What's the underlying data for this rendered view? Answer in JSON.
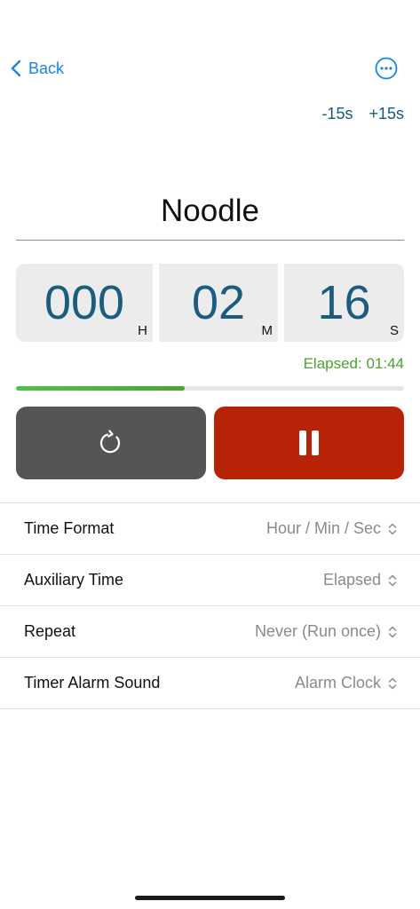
{
  "nav": {
    "back_label": "Back"
  },
  "adjust": {
    "minus_label": "-15s",
    "plus_label": "+15s"
  },
  "timer": {
    "name": "Noodle",
    "hours": "000",
    "hours_unit": "H",
    "minutes": "02",
    "minutes_unit": "M",
    "seconds": "16",
    "seconds_unit": "S",
    "elapsed_text": "Elapsed: 01:44",
    "progress_fraction": 0.435
  },
  "controls": {
    "reset_icon": "reset-icon",
    "pause_icon": "pause-icon"
  },
  "settings": {
    "items": [
      {
        "label": "Time Format",
        "value": "Hour / Min / Sec"
      },
      {
        "label": "Auxiliary Time",
        "value": "Elapsed"
      },
      {
        "label": "Repeat",
        "value": "Never (Run once)"
      },
      {
        "label": "Timer Alarm Sound",
        "value": "Alarm Clock"
      }
    ]
  },
  "colors": {
    "accent_blue": "#1a84e6",
    "digit_blue": "#1b5c80",
    "elapsed_green": "#4ea22e",
    "pause_red": "#b72306",
    "reset_gray": "#555555"
  }
}
